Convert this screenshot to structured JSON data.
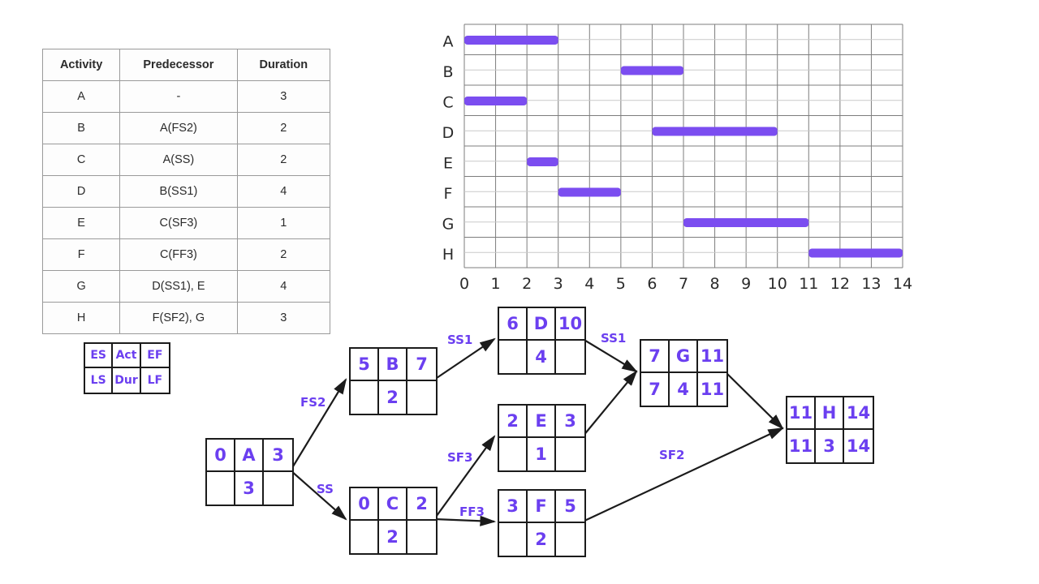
{
  "table": {
    "headers": [
      "Activity",
      "Predecessor",
      "Duration"
    ],
    "rows": [
      {
        "activity": "A",
        "predecessor": "-",
        "duration": "3"
      },
      {
        "activity": "B",
        "predecessor": "A(FS2)",
        "duration": "2"
      },
      {
        "activity": "C",
        "predecessor": "A(SS)",
        "duration": "2"
      },
      {
        "activity": "D",
        "predecessor": "B(SS1)",
        "duration": "4"
      },
      {
        "activity": "E",
        "predecessor": "C(SF3)",
        "duration": "1"
      },
      {
        "activity": "F",
        "predecessor": "C(FF3)",
        "duration": "2"
      },
      {
        "activity": "G",
        "predecessor": "D(SS1), E",
        "duration": "4"
      },
      {
        "activity": "H",
        "predecessor": "F(SF2), G",
        "duration": "3"
      }
    ]
  },
  "chart_data": {
    "type": "bar",
    "title": "",
    "xlabel": "",
    "ylabel": "",
    "orientation": "horizontal",
    "grid": true,
    "xlim": [
      0,
      14
    ],
    "xticks": [
      "0",
      "1",
      "2",
      "3",
      "4",
      "5",
      "6",
      "7",
      "8",
      "9",
      "10",
      "11",
      "12",
      "13",
      "14"
    ],
    "categories": [
      "A",
      "B",
      "C",
      "D",
      "E",
      "F",
      "G",
      "H"
    ],
    "bar_color": "#7b4df0",
    "tasks": [
      {
        "name": "A",
        "start": 0,
        "end": 3,
        "duration": 3
      },
      {
        "name": "B",
        "start": 5,
        "end": 7,
        "duration": 2
      },
      {
        "name": "C",
        "start": 0,
        "end": 2,
        "duration": 2
      },
      {
        "name": "D",
        "start": 6,
        "end": 10,
        "duration": 4
      },
      {
        "name": "E",
        "start": 2,
        "end": 3,
        "duration": 1
      },
      {
        "name": "F",
        "start": 3,
        "end": 5,
        "duration": 2
      },
      {
        "name": "G",
        "start": 7,
        "end": 11,
        "duration": 4
      },
      {
        "name": "H",
        "start": 11,
        "end": 14,
        "duration": 3
      }
    ]
  },
  "network": {
    "legend": {
      "es": "ES",
      "act": "Act",
      "ef": "EF",
      "ls": "LS",
      "dur": "Dur",
      "lf": "LF"
    },
    "nodes": [
      {
        "id": "A",
        "es": "0",
        "act": "A",
        "ef": "3",
        "ls": "",
        "dur": "3",
        "lf": ""
      },
      {
        "id": "B",
        "es": "5",
        "act": "B",
        "ef": "7",
        "ls": "",
        "dur": "2",
        "lf": ""
      },
      {
        "id": "C",
        "es": "0",
        "act": "C",
        "ef": "2",
        "ls": "",
        "dur": "2",
        "lf": ""
      },
      {
        "id": "D",
        "es": "6",
        "act": "D",
        "ef": "10",
        "ls": "",
        "dur": "4",
        "lf": ""
      },
      {
        "id": "E",
        "es": "2",
        "act": "E",
        "ef": "3",
        "ls": "",
        "dur": "1",
        "lf": ""
      },
      {
        "id": "F",
        "es": "3",
        "act": "F",
        "ef": "5",
        "ls": "",
        "dur": "2",
        "lf": ""
      },
      {
        "id": "G",
        "es": "7",
        "act": "G",
        "ef": "11",
        "ls": "7",
        "dur": "4",
        "lf": "11"
      },
      {
        "id": "H",
        "es": "11",
        "act": "H",
        "ef": "14",
        "ls": "11",
        "dur": "3",
        "lf": "14"
      }
    ],
    "edges": [
      {
        "from": "A",
        "to": "B",
        "label": "FS2"
      },
      {
        "from": "A",
        "to": "C",
        "label": "SS"
      },
      {
        "from": "B",
        "to": "D",
        "label": "SS1"
      },
      {
        "from": "C",
        "to": "E",
        "label": "SF3"
      },
      {
        "from": "C",
        "to": "F",
        "label": "FF3"
      },
      {
        "from": "D",
        "to": "G",
        "label": "SS1"
      },
      {
        "from": "E",
        "to": "G",
        "label": ""
      },
      {
        "from": "F",
        "to": "H",
        "label": "SF2"
      },
      {
        "from": "G",
        "to": "H",
        "label": ""
      }
    ]
  },
  "colors": {
    "bar": "#7b4df0",
    "ink": "#6b3ff0",
    "line": "#1b1b1b"
  }
}
